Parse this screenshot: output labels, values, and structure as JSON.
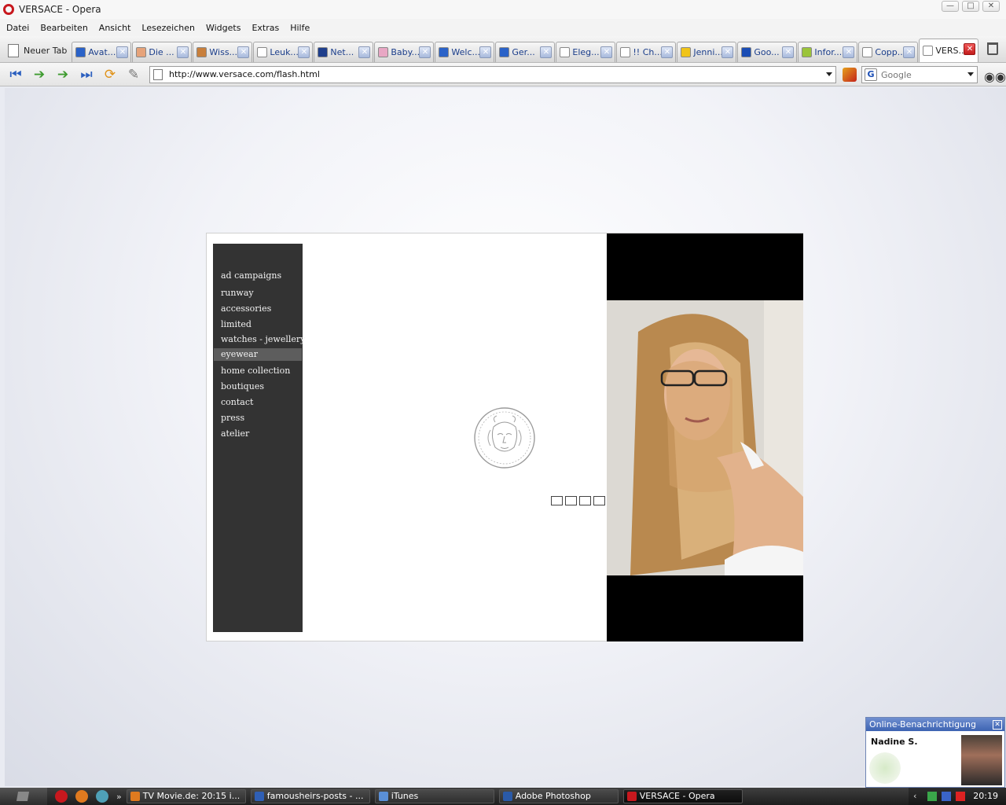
{
  "window": {
    "title": "VERSACE - Opera"
  },
  "menu": [
    "Datei",
    "Bearbeiten",
    "Ansicht",
    "Lesezeichen",
    "Widgets",
    "Extras",
    "Hilfe"
  ],
  "new_tab_label": "Neuer Tab",
  "tabs": [
    {
      "label": "Avat...",
      "icon_color": "#2a62c8"
    },
    {
      "label": "Die ...",
      "icon_color": "#e6a37a"
    },
    {
      "label": "Wiss...",
      "icon_color": "#c87f3c"
    },
    {
      "label": "Leuk...",
      "icon_color": "#ffffff"
    },
    {
      "label": "Net...",
      "icon_color": "#1f3f8c"
    },
    {
      "label": "Baby...",
      "icon_color": "#e8a7c4"
    },
    {
      "label": "Welc...",
      "icon_color": "#2a62c8"
    },
    {
      "label": "Ger...",
      "icon_color": "#2a62c8"
    },
    {
      "label": "Eleg...",
      "icon_color": "#ffffff"
    },
    {
      "label": "!! Ch...",
      "icon_color": "#ffffff"
    },
    {
      "label": "Jenni...",
      "icon_color": "#f0c419"
    },
    {
      "label": "Goo...",
      "icon_color": "#1a4db5"
    },
    {
      "label": "Infor...",
      "icon_color": "#9bc43a"
    },
    {
      "label": "Copp...",
      "icon_color": "#ffffff"
    },
    {
      "label": "VERS...",
      "icon_color": "#ffffff",
      "active": true
    }
  ],
  "address": {
    "url": "http://www.versace.com/flash.html"
  },
  "search": {
    "placeholder": "Google",
    "engine_letter": "G"
  },
  "page": {
    "nav": [
      {
        "label": "ad campaigns"
      },
      {
        "label": "runway"
      },
      {
        "label": "accessories"
      },
      {
        "label": "limited"
      },
      {
        "label": "watches - jewellery"
      },
      {
        "label": "eyewear",
        "active": true
      },
      {
        "label": "home collection"
      },
      {
        "label": "boutiques"
      },
      {
        "label": "contact"
      },
      {
        "label": "press"
      },
      {
        "label": "atelier"
      }
    ],
    "slides_count": 4
  },
  "notification": {
    "header": "Online-Benachrichtigung",
    "name": "Nadine S."
  },
  "taskbar": {
    "tasks": [
      {
        "label": "TV Movie.de: 20:15 i...",
        "icon_color": "#e07a1f"
      },
      {
        "label": "famousheirs-posts - ...",
        "icon_color": "#2f5fb5"
      },
      {
        "label": "iTunes",
        "icon_color": "#5a8fd6"
      },
      {
        "label": "Adobe Photoshop",
        "icon_color": "#2a5aa8"
      },
      {
        "label": "VERSACE - Opera",
        "icon_color": "#c8181e",
        "active": true
      }
    ],
    "clock": "20:19"
  }
}
